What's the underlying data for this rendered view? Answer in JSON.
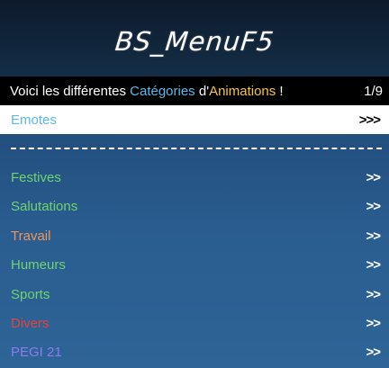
{
  "banner": {
    "title": "BS_MenuF5"
  },
  "subtitle": {
    "prefix": "Voici les différentes ",
    "highlight1": "Catégories",
    "middle": " d'",
    "highlight2": "Animations",
    "suffix": " !",
    "counter": "1/9"
  },
  "colors": {
    "header_bg": "#0d1a2b",
    "subtitle_bg": "#000000",
    "list_bg": "#2a5c8f",
    "selected_bg": "#ffffff",
    "highlight_blue": "#5cb8ea",
    "highlight_yellow": "#f4c541"
  },
  "items": [
    {
      "label": "Emotes",
      "arrow": ">>>",
      "color": "#5cb8ea",
      "selected": true
    },
    {
      "label": "Festives",
      "arrow": ">>",
      "color": "#6fd36f",
      "selected": false
    },
    {
      "label": "Salutations",
      "arrow": ">>",
      "color": "#6fd36f",
      "selected": false
    },
    {
      "label": "Travail",
      "arrow": ">>",
      "color": "#f0955a",
      "selected": false
    },
    {
      "label": "Humeurs",
      "arrow": ">>",
      "color": "#6fd36f",
      "selected": false
    },
    {
      "label": "Sports",
      "arrow": ">>",
      "color": "#6fd36f",
      "selected": false
    },
    {
      "label": "Divers",
      "arrow": ">>",
      "color": "#e0443c",
      "selected": false
    },
    {
      "label": "PEGI 21",
      "arrow": ">>",
      "color": "#8b7cf0",
      "selected": false
    }
  ]
}
